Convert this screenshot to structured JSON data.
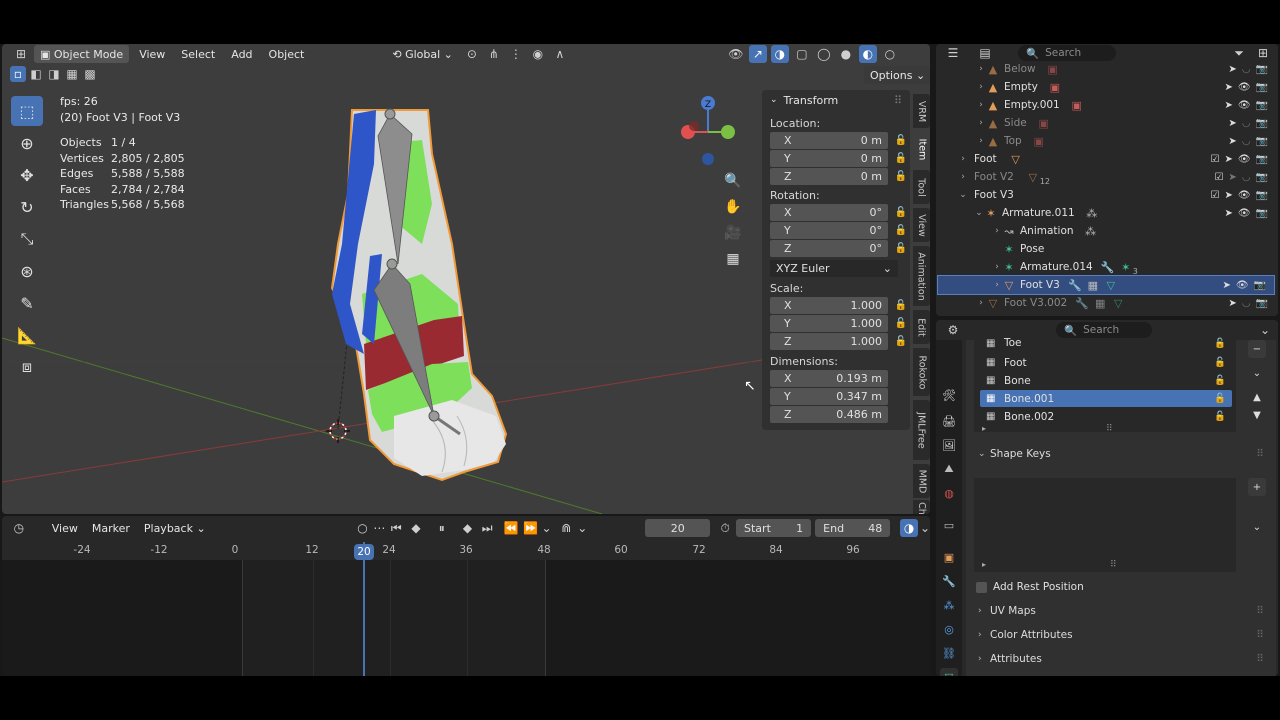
{
  "viewport": {
    "mode": "Object Mode",
    "menus": [
      "View",
      "Select",
      "Add",
      "Object"
    ],
    "transform_orientation": "Global",
    "options_label": "Options",
    "stats": {
      "fps": "fps: 26",
      "context": "(20) Foot V3 | Foot V3",
      "rows": [
        {
          "k": "Objects",
          "v": "1 / 4"
        },
        {
          "k": "Vertices",
          "v": "2,805 / 2,805"
        },
        {
          "k": "Edges",
          "v": "5,588 / 5,588"
        },
        {
          "k": "Faces",
          "v": "2,784 / 2,784"
        },
        {
          "k": "Triangles",
          "v": "5,568 / 5,568"
        }
      ]
    },
    "gizmo_label": "Z"
  },
  "npanel": {
    "title": "Transform",
    "location_label": "Location:",
    "location": [
      {
        "a": "X",
        "v": "0 m"
      },
      {
        "a": "Y",
        "v": "0 m"
      },
      {
        "a": "Z",
        "v": "0 m"
      }
    ],
    "rotation_label": "Rotation:",
    "rotation": [
      {
        "a": "X",
        "v": "0°"
      },
      {
        "a": "Y",
        "v": "0°"
      },
      {
        "a": "Z",
        "v": "0°"
      }
    ],
    "rotation_mode": "XYZ Euler",
    "scale_label": "Scale:",
    "scale": [
      {
        "a": "X",
        "v": "1.000"
      },
      {
        "a": "Y",
        "v": "1.000"
      },
      {
        "a": "Z",
        "v": "1.000"
      }
    ],
    "dimensions_label": "Dimensions:",
    "dimensions": [
      {
        "a": "X",
        "v": "0.193 m"
      },
      {
        "a": "Y",
        "v": "0.347 m"
      },
      {
        "a": "Z",
        "v": "0.486 m"
      }
    ],
    "tabs": [
      "VRM",
      "Item",
      "Tool",
      "View",
      "Animation",
      "Edit",
      "Rokoko",
      "JMLFree",
      "MMD",
      "Ch"
    ]
  },
  "timeline": {
    "menus": [
      "View",
      "Marker",
      "Playback"
    ],
    "current_frame": "20",
    "start_label": "Start",
    "start": "1",
    "end_label": "End",
    "end": "48",
    "ticks": [
      "-24",
      "-12",
      "0",
      "12",
      "24",
      "36",
      "48",
      "60",
      "72",
      "84",
      "96"
    ],
    "playhead_label": "20"
  },
  "outliner": {
    "search_placeholder": "Search",
    "rows": [
      {
        "name": "Below",
        "dim": true
      },
      {
        "name": "Empty",
        "dim": false
      },
      {
        "name": "Empty.001",
        "dim": false
      },
      {
        "name": "Side",
        "dim": true
      },
      {
        "name": "Top",
        "dim": true
      },
      {
        "name": "Foot",
        "dim": false
      },
      {
        "name": "Foot V2",
        "dim": true
      },
      {
        "name": "Foot V3",
        "dim": false
      },
      {
        "name": "Armature.011",
        "dim": false
      },
      {
        "name": "Animation",
        "dim": false
      },
      {
        "name": "Pose",
        "dim": false
      },
      {
        "name": "Armature.014",
        "dim": false
      },
      {
        "name": "Foot V3",
        "dim": false
      },
      {
        "name": "Foot V3.002",
        "dim": true
      }
    ],
    "badge_v2": "12",
    "badge_arm": "3"
  },
  "properties": {
    "search_placeholder": "Search",
    "vertex_groups": [
      "Toe",
      "Foot",
      "Bone",
      "Bone.001",
      "Bone.002"
    ],
    "shape_keys_label": "Shape Keys",
    "add_rest_position": "Add Rest Position",
    "uv_maps": "UV Maps",
    "color_attributes": "Color Attributes",
    "attributes": "Attributes"
  },
  "colors": {
    "accent": "#4772b3",
    "selection": "#334d80",
    "viewport_bg": "#3d3d3d",
    "mesh_green": "#7ee05a",
    "mesh_blue": "#2f56c8",
    "mesh_red": "#9a2a32",
    "outline_orange": "#f09a3a"
  }
}
